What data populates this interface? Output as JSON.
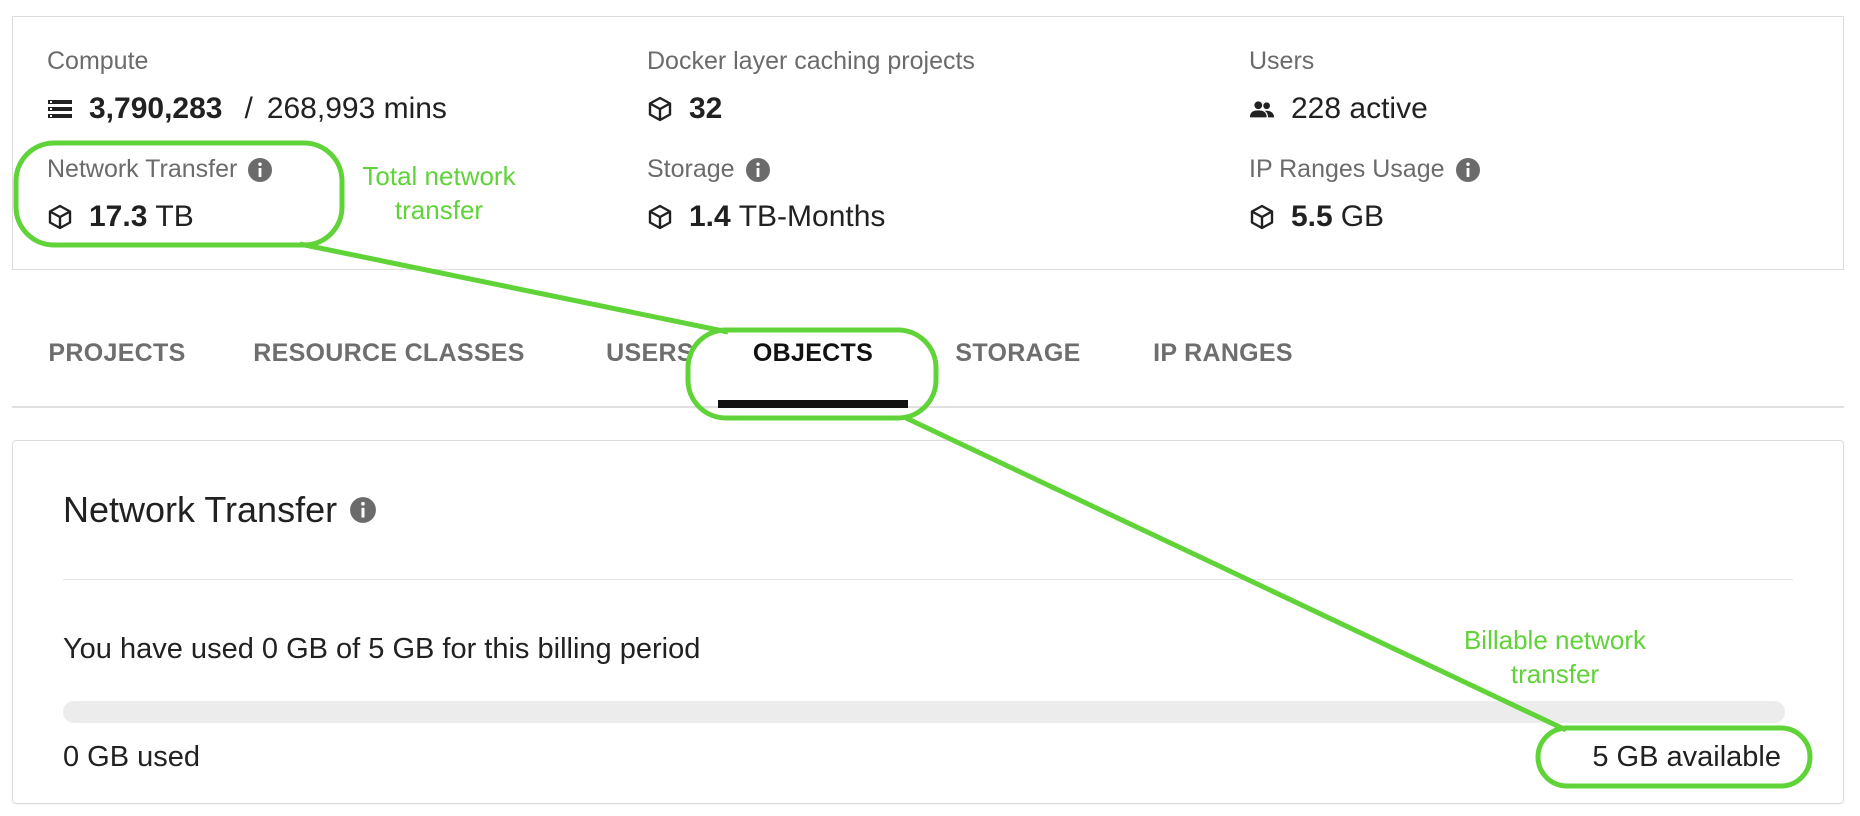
{
  "stats": {
    "compute": {
      "label": "Compute",
      "used": "3,790,283",
      "separator": "/",
      "limit": "268,993 mins",
      "icon": "server-stack-icon"
    },
    "docker": {
      "label": "Docker layer caching projects",
      "value": "32",
      "icon": "cube-icon"
    },
    "users": {
      "label": "Users",
      "value": "228 active",
      "icon": "people-icon"
    },
    "network": {
      "label": "Network Transfer",
      "value": "17.3",
      "unit": "TB",
      "icon": "cube-icon"
    },
    "storage": {
      "label": "Storage",
      "value": "1.4",
      "unit": "TB-Months",
      "icon": "cube-icon"
    },
    "ip_ranges": {
      "label": "IP Ranges Usage",
      "value": "5.5",
      "unit": "GB",
      "icon": "cube-icon"
    }
  },
  "tabs": [
    {
      "label": "PROJECTS",
      "active": false
    },
    {
      "label": "RESOURCE CLASSES",
      "active": false
    },
    {
      "label": "USERS",
      "active": false
    },
    {
      "label": "OBJECTS",
      "active": true
    },
    {
      "label": "STORAGE",
      "active": false
    },
    {
      "label": "IP RANGES",
      "active": false
    }
  ],
  "card": {
    "title": "Network Transfer",
    "usage_text": "You have used 0 GB of 5 GB for this billing period",
    "progress_fraction": 0,
    "used_label": "0 GB used",
    "available_label": "5 GB available"
  },
  "annotations": {
    "total_note_line1": "Total network",
    "total_note_line2": "transfer",
    "billable_note_line1": "Billable network",
    "billable_note_line2": "transfer",
    "color": "#5fd338"
  }
}
